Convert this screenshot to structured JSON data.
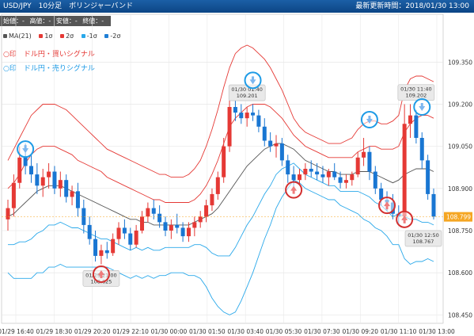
{
  "header": {
    "symbol_label": "USD/JPY　10分足　ボリンジャーバンド",
    "updated_label": "最新更新時間：2018/01/30 13:00"
  },
  "ohlc": {
    "open": "始値：-",
    "high": "高値：-",
    "low": "安値：-",
    "close": "終値：-"
  },
  "legend": [
    {
      "label": "MA(21)",
      "color": "#555555"
    },
    {
      "label": "1σ",
      "color": "#e53935"
    },
    {
      "label": "2σ",
      "color": "#e53935"
    },
    {
      "label": "-1σ",
      "color": "#29a8ea"
    },
    {
      "label": "-2σ",
      "color": "#1f7fd6"
    }
  ],
  "signals": {
    "buy": "○印　ドル円・買いシグナル",
    "sell": "○印　ドル円・売りシグナル"
  },
  "colors": {
    "up": "#e53935",
    "down": "#1976d2",
    "ma": "#555555",
    "band_upper": "#e53935",
    "band_lower": "#29a8ea",
    "current_price_bg": "#f5a623"
  },
  "chart_data": {
    "type": "candlestick",
    "title": "USD/JPY 10分足 ボリンジャーバンド",
    "ylim": [
      108.42,
      109.52
    ],
    "y_ticks": [
      "109.350",
      "109.200",
      "109.050",
      "108.900",
      "108.750",
      "108.600",
      "108.450"
    ],
    "x_ticks": [
      "01/29 16:40",
      "01/29 18:30",
      "01/29 20:20",
      "01/29 22:10",
      "01/30 00:00",
      "01/30 01:50",
      "01/30 03:40",
      "01/30 05:30",
      "01/30 07:30",
      "01/30 09:20",
      "01/30 11:10",
      "01/30 13:00"
    ],
    "current_price": 108.799,
    "current_price_label": "108.799",
    "candles": [
      [
        108.79,
        108.86,
        108.75,
        108.83
      ],
      [
        108.83,
        108.95,
        108.8,
        108.92
      ],
      [
        108.92,
        109.05,
        108.9,
        109.01
      ],
      [
        109.01,
        109.06,
        108.95,
        108.98
      ],
      [
        108.98,
        109.02,
        108.92,
        108.95
      ],
      [
        108.95,
        108.99,
        108.88,
        108.91
      ],
      [
        108.91,
        108.97,
        108.87,
        108.94
      ],
      [
        108.94,
        108.99,
        108.9,
        108.96
      ],
      [
        108.96,
        108.98,
        108.88,
        108.9
      ],
      [
        108.9,
        108.96,
        108.87,
        108.93
      ],
      [
        108.93,
        108.95,
        108.85,
        108.87
      ],
      [
        108.87,
        108.91,
        108.84,
        108.89
      ],
      [
        108.89,
        108.92,
        108.8,
        108.83
      ],
      [
        108.83,
        108.86,
        108.74,
        108.77
      ],
      [
        108.77,
        108.8,
        108.7,
        108.72
      ],
      [
        108.72,
        108.75,
        108.64,
        108.66
      ],
      [
        108.66,
        108.7,
        108.63,
        108.68
      ],
      [
        108.68,
        108.71,
        108.65,
        108.67
      ],
      [
        108.67,
        108.74,
        108.66,
        108.72
      ],
      [
        108.72,
        108.78,
        108.7,
        108.76
      ],
      [
        108.76,
        108.79,
        108.72,
        108.74
      ],
      [
        108.74,
        108.76,
        108.68,
        108.7
      ],
      [
        108.7,
        108.77,
        108.69,
        108.75
      ],
      [
        108.75,
        108.82,
        108.74,
        108.8
      ],
      [
        108.8,
        108.85,
        108.78,
        108.83
      ],
      [
        108.83,
        108.86,
        108.79,
        108.81
      ],
      [
        108.81,
        108.84,
        108.76,
        108.78
      ],
      [
        108.78,
        108.8,
        108.73,
        108.75
      ],
      [
        108.75,
        108.79,
        108.72,
        108.77
      ],
      [
        108.77,
        108.81,
        108.74,
        108.76
      ],
      [
        108.76,
        108.78,
        108.71,
        108.73
      ],
      [
        108.73,
        108.78,
        108.71,
        108.76
      ],
      [
        108.76,
        108.8,
        108.73,
        108.78
      ],
      [
        108.78,
        108.82,
        108.76,
        108.8
      ],
      [
        108.8,
        108.86,
        108.78,
        108.84
      ],
      [
        108.84,
        108.9,
        108.82,
        108.88
      ],
      [
        108.88,
        108.96,
        108.86,
        108.94
      ],
      [
        108.94,
        109.08,
        108.92,
        109.05
      ],
      [
        109.05,
        109.22,
        109.03,
        109.19
      ],
      [
        109.19,
        109.22,
        109.14,
        109.17
      ],
      [
        109.17,
        109.2,
        109.13,
        109.15
      ],
      [
        109.15,
        109.19,
        109.12,
        109.17
      ],
      [
        109.17,
        109.2,
        109.14,
        109.16
      ],
      [
        109.16,
        109.18,
        109.1,
        109.12
      ],
      [
        109.12,
        109.15,
        109.05,
        109.07
      ],
      [
        109.07,
        109.1,
        109.03,
        109.05
      ],
      [
        109.05,
        109.09,
        109.01,
        109.06
      ],
      [
        109.06,
        109.08,
        108.98,
        109.0
      ],
      [
        109.0,
        109.02,
        108.92,
        108.95
      ],
      [
        108.95,
        108.98,
        108.9,
        108.93
      ],
      [
        108.93,
        108.97,
        108.91,
        108.95
      ],
      [
        108.95,
        108.99,
        108.93,
        108.97
      ],
      [
        108.97,
        109.0,
        108.94,
        108.96
      ],
      [
        108.96,
        108.99,
        108.93,
        108.95
      ],
      [
        108.95,
        108.98,
        108.92,
        108.94
      ],
      [
        108.94,
        108.97,
        108.91,
        108.96
      ],
      [
        108.96,
        108.99,
        108.93,
        108.94
      ],
      [
        108.94,
        108.96,
        108.9,
        108.92
      ],
      [
        108.92,
        108.95,
        108.9,
        108.93
      ],
      [
        108.93,
        108.96,
        108.91,
        108.95
      ],
      [
        108.95,
        109.03,
        108.94,
        109.01
      ],
      [
        109.01,
        109.08,
        108.98,
        109.03
      ],
      [
        109.03,
        109.05,
        108.93,
        108.96
      ],
      [
        108.96,
        108.98,
        108.88,
        108.9
      ],
      [
        108.9,
        108.92,
        108.84,
        108.86
      ],
      [
        108.86,
        108.89,
        108.82,
        108.85
      ],
      [
        108.85,
        108.88,
        108.79,
        108.81
      ],
      [
        108.81,
        108.84,
        108.77,
        108.8
      ],
      [
        108.8,
        109.2,
        108.79,
        109.13
      ],
      [
        109.13,
        109.2,
        109.08,
        109.16
      ],
      [
        109.16,
        109.18,
        109.06,
        109.08
      ],
      [
        109.08,
        109.1,
        108.97,
        109.0
      ],
      [
        109.0,
        109.02,
        108.86,
        108.88
      ],
      [
        108.88,
        108.9,
        108.79,
        108.8
      ]
    ],
    "ma21": [
      108.8,
      108.81,
      108.83,
      108.85,
      108.87,
      108.89,
      108.9,
      108.91,
      108.91,
      108.91,
      108.9,
      108.89,
      108.88,
      108.87,
      108.86,
      108.85,
      108.84,
      108.83,
      108.82,
      108.81,
      108.8,
      108.79,
      108.79,
      108.78,
      108.78,
      108.77,
      108.77,
      108.77,
      108.77,
      108.77,
      108.77,
      108.77,
      108.78,
      108.79,
      108.8,
      108.81,
      108.83,
      108.86,
      108.89,
      108.92,
      108.95,
      108.98,
      109.0,
      109.02,
      109.04,
      109.05,
      109.06,
      109.06,
      109.05,
      109.04,
      109.02,
      109.0,
      108.99,
      108.98,
      108.97,
      108.96,
      108.96,
      108.95,
      108.95,
      108.95,
      108.96,
      108.96,
      108.96,
      108.95,
      108.94,
      108.93,
      108.92,
      108.93,
      108.95,
      108.96,
      108.97,
      108.97,
      108.97,
      108.96
    ],
    "sigma1_upper": [
      108.9,
      108.92,
      108.95,
      108.99,
      109.02,
      109.04,
      109.05,
      109.05,
      109.05,
      109.04,
      109.03,
      109.02,
      109.0,
      108.99,
      108.98,
      108.97,
      108.96,
      108.94,
      108.93,
      108.92,
      108.91,
      108.9,
      108.89,
      108.88,
      108.87,
      108.86,
      108.86,
      108.85,
      108.85,
      108.85,
      108.85,
      108.85,
      108.86,
      108.88,
      108.91,
      108.95,
      109.0,
      109.06,
      109.12,
      109.15,
      109.17,
      109.19,
      109.2,
      109.2,
      109.2,
      109.19,
      109.17,
      109.15,
      109.12,
      109.09,
      109.07,
      109.05,
      109.04,
      109.03,
      109.02,
      109.01,
      109.01,
      109.01,
      109.01,
      109.01,
      109.03,
      109.04,
      109.05,
      109.05,
      109.04,
      109.04,
      109.04,
      109.05,
      109.1,
      109.13,
      109.15,
      109.16,
      109.16,
      109.15
    ],
    "sigma2_upper": [
      109.0,
      109.04,
      109.08,
      109.12,
      109.16,
      109.18,
      109.2,
      109.2,
      109.2,
      109.19,
      109.18,
      109.16,
      109.14,
      109.12,
      109.1,
      109.08,
      109.06,
      109.04,
      109.03,
      109.02,
      109.01,
      109.0,
      108.99,
      108.98,
      108.97,
      108.96,
      108.95,
      108.95,
      108.94,
      108.94,
      108.94,
      108.95,
      108.97,
      109.0,
      109.05,
      109.11,
      109.18,
      109.26,
      109.33,
      109.38,
      109.4,
      109.41,
      109.4,
      109.38,
      109.36,
      109.33,
      109.29,
      109.25,
      109.2,
      109.15,
      109.12,
      109.1,
      109.09,
      109.08,
      109.07,
      109.06,
      109.06,
      109.06,
      109.07,
      109.08,
      109.11,
      109.13,
      109.14,
      109.14,
      109.13,
      109.13,
      109.14,
      109.16,
      109.25,
      109.29,
      109.3,
      109.3,
      109.29,
      109.28
    ],
    "sigma1_lower": [
      108.7,
      108.7,
      108.71,
      108.71,
      108.72,
      108.74,
      108.75,
      108.77,
      108.77,
      108.78,
      108.77,
      108.76,
      108.76,
      108.75,
      108.74,
      108.73,
      108.72,
      108.72,
      108.71,
      108.7,
      108.69,
      108.68,
      108.69,
      108.68,
      108.69,
      108.68,
      108.68,
      108.69,
      108.69,
      108.69,
      108.69,
      108.69,
      108.7,
      108.7,
      108.69,
      108.67,
      108.66,
      108.66,
      108.66,
      108.69,
      108.73,
      108.77,
      108.8,
      108.84,
      108.88,
      108.91,
      108.95,
      108.97,
      108.98,
      108.99,
      108.97,
      108.95,
      108.94,
      108.93,
      108.92,
      108.91,
      108.91,
      108.89,
      108.89,
      108.89,
      108.89,
      108.88,
      108.87,
      108.85,
      108.84,
      108.82,
      108.8,
      108.81,
      108.8,
      108.79,
      108.79,
      108.78,
      108.78,
      108.77
    ],
    "sigma2_lower": [
      108.6,
      108.58,
      108.58,
      108.58,
      108.58,
      108.6,
      108.6,
      108.62,
      108.62,
      108.63,
      108.62,
      108.62,
      108.62,
      108.62,
      108.62,
      108.62,
      108.62,
      108.62,
      108.61,
      108.6,
      108.59,
      108.58,
      108.59,
      108.58,
      108.59,
      108.58,
      108.59,
      108.59,
      108.6,
      108.6,
      108.6,
      108.59,
      108.59,
      108.58,
      108.55,
      108.51,
      108.48,
      108.46,
      108.45,
      108.46,
      108.5,
      108.55,
      108.6,
      108.66,
      108.72,
      108.77,
      108.83,
      108.87,
      108.9,
      108.93,
      108.92,
      108.9,
      108.89,
      108.88,
      108.87,
      108.86,
      108.86,
      108.84,
      108.83,
      108.82,
      108.81,
      108.79,
      108.78,
      108.76,
      108.75,
      108.73,
      108.7,
      108.7,
      108.65,
      108.63,
      108.64,
      108.64,
      108.65,
      108.64
    ],
    "annotations": [
      {
        "label": "01/30 01:40\n109.201",
        "index": 41,
        "value": 109.201,
        "position": "above"
      },
      {
        "label": "01/30 11:40\n109.202",
        "index": 70,
        "value": 109.202,
        "position": "above"
      },
      {
        "label": "01/29 21:00\n108.625",
        "index": 16,
        "value": 108.625,
        "position": "below"
      },
      {
        "label": "01/30 12:50\n108.767",
        "index": 73,
        "value": 108.767,
        "position": "below"
      }
    ],
    "signal_markers": [
      {
        "type": "sell",
        "index": 3,
        "value": 109.04
      },
      {
        "type": "sell",
        "index": 42,
        "value": 109.285
      },
      {
        "type": "sell",
        "index": 62,
        "value": 109.145
      },
      {
        "type": "sell",
        "index": 71,
        "value": 109.19
      },
      {
        "type": "buy",
        "index": 16,
        "value": 108.595
      },
      {
        "type": "buy",
        "index": 49,
        "value": 108.895
      },
      {
        "type": "buy",
        "index": 65,
        "value": 108.84
      },
      {
        "type": "buy",
        "index": 68,
        "value": 108.79
      }
    ]
  }
}
